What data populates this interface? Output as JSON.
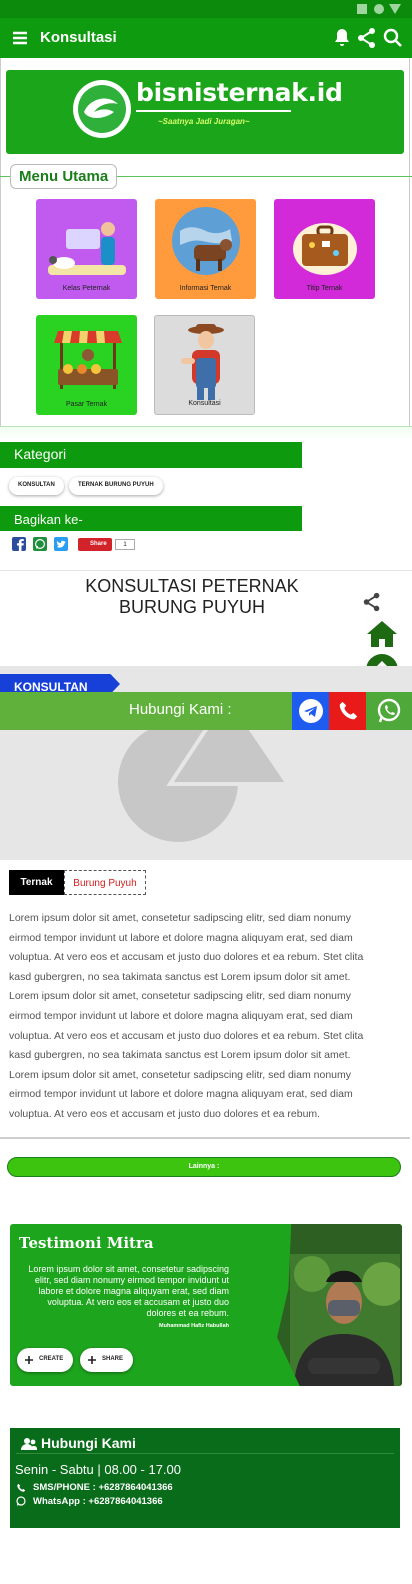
{
  "appbar": {
    "title": "Konsultasi"
  },
  "banner": {
    "brand": "bisnisternak.id",
    "tagline": "~Saatnya Jadi Juragan~"
  },
  "menu": {
    "title": "Menu Utama",
    "items": [
      {
        "label": "Kelas Peternak",
        "color": "#c15bf0"
      },
      {
        "label": "Informasi Ternak",
        "color": "#ff9b3d"
      },
      {
        "label": "Titip Ternak",
        "color": "#d229d9"
      },
      {
        "label": "Pasar Ternak",
        "color": "#2ad322"
      },
      {
        "label": "Konsultasi",
        "color": "#dcdcdc"
      }
    ]
  },
  "kategori": {
    "title": "Kategori",
    "chips": [
      "KONSULTAN",
      "TERNAK BURUNG PUYUH"
    ]
  },
  "share": {
    "title": "Bagikan ke-",
    "button": "Share",
    "count": "1"
  },
  "post": {
    "title": "KONSULTASI PETERNAK BURUNG PUYUH",
    "category_label": "KONSULTAN",
    "tags": [
      "Ternak",
      "Burung Puyuh"
    ],
    "body": "Lorem ipsum dolor sit amet, consetetur sadipscing elitr, sed diam nonumy eirmod tempor invidunt ut labore et dolore magna aliquyam erat, sed diam voluptua. At vero eos et accusam et justo duo dolores et ea rebum. Stet clita kasd gubergren, no sea takimata sanctus est Lorem ipsum dolor sit amet. Lorem ipsum dolor sit amet, consetetur sadipscing elitr, sed diam nonumy eirmod tempor invidunt ut labore et dolore magna aliquyam erat, sed diam voluptua. At vero eos et accusam et justo duo dolores et ea rebum. Stet clita kasd gubergren, no sea takimata sanctus est Lorem ipsum dolor sit amet. Lorem ipsum dolor sit amet, consetetur sadipscing elitr, sed diam nonumy eirmod tempor invidunt ut labore et dolore magna aliquyam erat, sed diam voluptua. At vero eos et accusam et justo duo dolores et ea rebum."
  },
  "contact_bar": {
    "label": "Hubungi Kami :"
  },
  "lainnya": {
    "label": "Lainnya :"
  },
  "testimoni": {
    "title": "Testimoni Mitra",
    "quote": "Lorem ipsum dolor sit amet, consetetur sadipscing elitr, sed diam nonumy eirmod tempor invidunt ut labore et dolore magna aliquyam erat, sed diam voluptua. At vero eos et accusam et justo duo dolores et ea rebum.",
    "author": "Muhammad Hafiz Habullah",
    "create_label": "CREATE",
    "share_label": "SHARE"
  },
  "footer": {
    "title": "Hubungi Kami",
    "hours": "Senin - Sabtu | 08.00 - 17.00",
    "phone": "SMS/PHONE : +6287864041366",
    "whatsapp": "WhatsApp : +6287864041366"
  },
  "colors": {
    "primary": "#0f9b0f",
    "telegram": "#1e5cf0",
    "phone": "#e81a1a",
    "whatsapp": "#4fa83a",
    "footer": "#086c1a"
  }
}
